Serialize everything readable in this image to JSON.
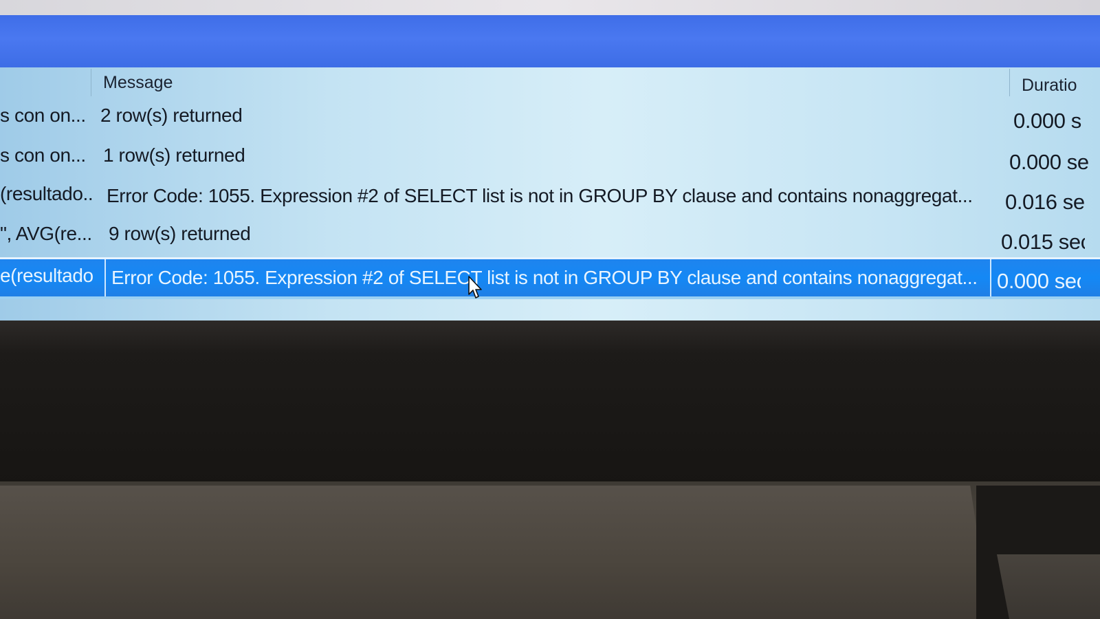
{
  "grid": {
    "columns": {
      "message": "Message",
      "duration": "Duratio"
    },
    "rows": [
      {
        "action": "s con  on...",
        "message": "2 row(s) returned",
        "duration": "0.000 s"
      },
      {
        "action": "s con  on...",
        "message": "1 row(s) returned",
        "duration": "0.000 se"
      },
      {
        "action": "(resultado...",
        "message": "Error Code: 1055. Expression #2 of SELECT list is not in GROUP BY clause and contains nonaggregat...",
        "duration": "0.016 se"
      },
      {
        "action": "\", AVG(re...",
        "message": "9 row(s) returned",
        "duration": "0.015 sec"
      },
      {
        "action": "e(resultado...",
        "message": "Error Code: 1055. Expression #2 of SELECT list is not in GROUP BY clause and contains nonaggregat...",
        "duration": "0.000 sec"
      }
    ],
    "selected_row": 4
  },
  "colors": {
    "header_bar": "#4a78f0",
    "selected_row": "#1488f5",
    "grid_background": "#d7eef8"
  },
  "icons": {
    "cursor": "mouse-pointer-icon"
  }
}
